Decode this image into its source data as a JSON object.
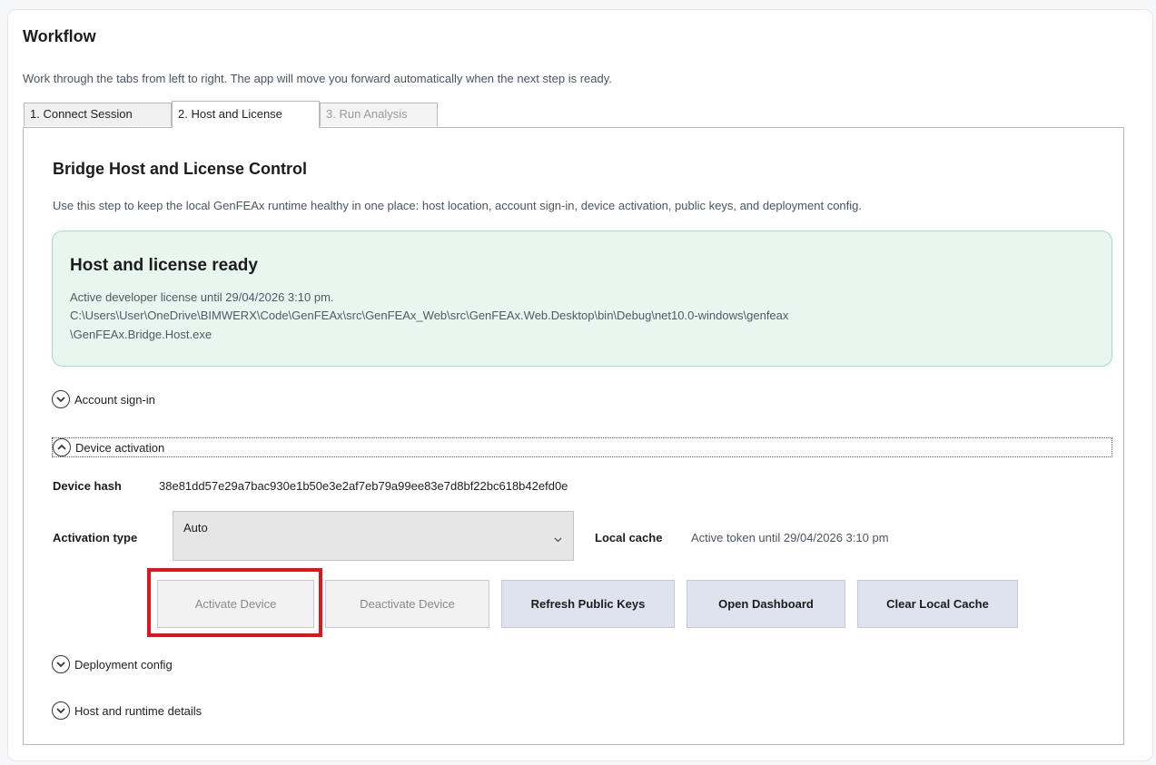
{
  "workflow": {
    "title": "Workflow",
    "subtitle": "Work through the tabs from left to right. The app will move you forward automatically when the next step is ready."
  },
  "tabs": [
    {
      "label": "1. Connect Session",
      "state": "normal"
    },
    {
      "label": "2. Host and License",
      "state": "active"
    },
    {
      "label": "3. Run Analysis",
      "state": "disabled"
    }
  ],
  "panel": {
    "title": "Bridge Host and License Control",
    "description": "Use this step to keep the local GenFEAx runtime healthy in one place: host location, account sign-in, device activation, public keys, and deployment config."
  },
  "status": {
    "title": "Host and license ready",
    "license_line": "Active developer license until 29/04/2026 3:10 pm.",
    "path_line1": "C:\\Users\\User\\OneDrive\\BIMWERX\\Code\\GenFEAx\\src\\GenFEAx_Web\\src\\GenFEAx.Web.Desktop\\bin\\Debug\\net10.0-windows\\genfeax",
    "path_line2": "\\GenFEAx.Bridge.Host.exe",
    "accent_color": "#9fdfbd",
    "background_color": "#e8f6ef"
  },
  "sections": {
    "account_signin": {
      "label": "Account sign-in",
      "icon": "chevron-down-circle-icon",
      "expanded": false
    },
    "device_activation": {
      "label": "Device activation",
      "icon": "chevron-up-circle-icon",
      "expanded": true
    },
    "deployment_config": {
      "label": "Deployment config",
      "icon": "chevron-down-circle-icon",
      "expanded": false
    },
    "host_runtime": {
      "label": "Host and runtime details",
      "icon": "chevron-down-circle-icon",
      "expanded": false
    }
  },
  "device": {
    "hash_label": "Device hash",
    "hash_value": "38e81dd57e29a7bac930e1b50e3e2af7eb79a99ee83e7d8bf22bc618b42efd0e",
    "activation_type_label": "Activation type",
    "activation_type_value": "Auto",
    "local_cache_label": "Local cache",
    "local_cache_value": "Active token until 29/04/2026 3:10 pm"
  },
  "buttons": {
    "activate": "Activate Device",
    "deactivate": "Deactivate Device",
    "refresh_keys": "Refresh Public Keys",
    "open_dashboard": "Open Dashboard",
    "clear_cache": "Clear Local Cache"
  },
  "highlight_color": "#e0141b"
}
